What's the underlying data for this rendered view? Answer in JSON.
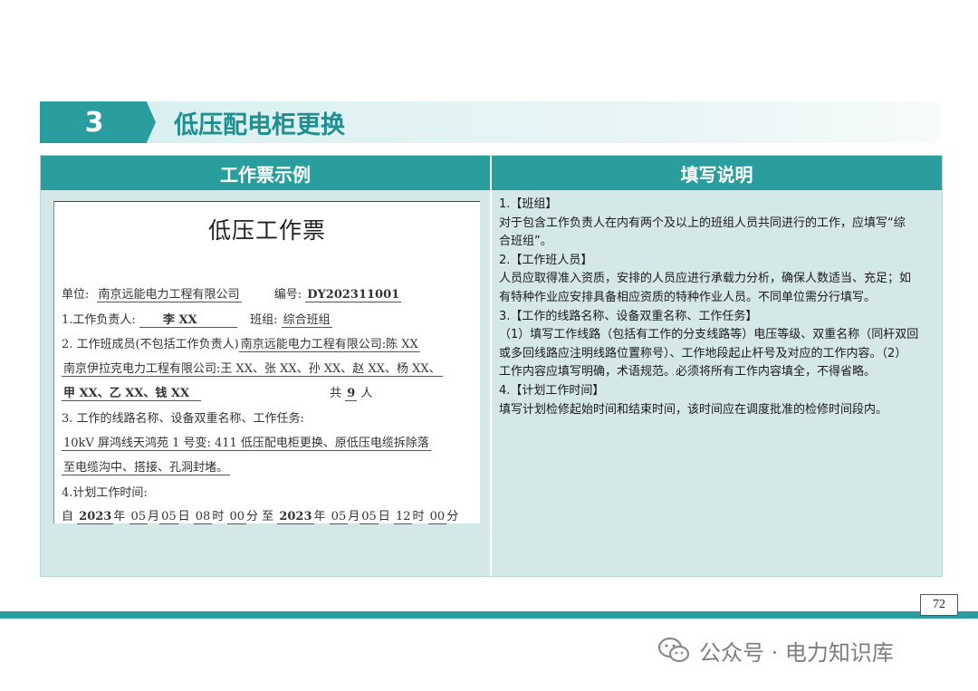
{
  "section": {
    "number": "3",
    "title": "低压配电柜更换"
  },
  "table": {
    "header_left": "工作票示例",
    "header_right": "填写说明"
  },
  "ticket": {
    "title": "低压工作票",
    "unit_label": "单位:",
    "unit_value": "南京远能电力工程有限公司",
    "number_label": "编号:",
    "number_value": "DY202311001",
    "leader_label": "1.工作负责人:",
    "leader_value": "李 XX",
    "team_label": "班组:",
    "team_value": "综合班组",
    "members_label": "2. 工作班成员(不包括工作负责人)",
    "members_line1_value": "南京远能电力工程有限公司:陈 XX",
    "members_line2_value": "南京伊拉克电力工程有限公司:王 XX、张 XX、孙 XX、赵 XX、杨 XX、",
    "members_line3_value": "甲 XX、乙 XX、钱 XX",
    "members_total_prefix": "共",
    "members_total_value": "9",
    "members_total_suffix": "人",
    "task_label": "3. 工作的线路名称、设备双重名称、工作任务:",
    "task_line1": "10kV 屏鸿线天鸿苑 1 号变: 411 低压配电柜更换、原低压电缆拆除落",
    "task_line2": "至电缆沟中、搭接、孔洞封堵。",
    "time_label": "4.计划工作时间:",
    "time_from": "自",
    "time_start_year": "2023",
    "time_start_month": "05",
    "time_start_day": "05",
    "time_start_hour": "08",
    "time_start_min": "00",
    "time_to": "至",
    "time_end_year": "2023",
    "time_end_month": "05",
    "time_end_day": "05",
    "time_end_hour": "12",
    "time_end_min": "00",
    "u_year": "年",
    "u_month": "月",
    "u_day": "日",
    "u_hour": "时",
    "u_min": "分"
  },
  "instructions": [
    "1.【班组】",
    "对于包含工作负责人在内有两个及以上的班组人员共同进行的工作，应填写“综",
    "合班组”。",
    "2.【工作班人员】",
    "人员应取得准入资质，安排的人员应进行承载力分析，确保人数适当、充足；如",
    "有特种作业应安排具备相应资质的特种作业人员。不同单位需分行填写。",
    "3.【工作的线路名称、设备双重名称、工作任务】",
    "（1）填写工作线路（包括有工作的分支线路等）电压等级、双重名称（同杆双回",
    "或多回线路应注明线路位置称号）、工作地段起止杆号及对应的工作内容。（2）",
    "工作内容应填写明确，术语规范。必须将所有工作内容填全，不得省略。",
    "4.【计划工作时间】",
    "填写计划检修起始时间和结束时间，该时间应在调度批准的检修时间段内。"
  ],
  "page_number": "72",
  "watermark": "公众号 · 电力知识库",
  "colors": {
    "accent": "#2a9e9f",
    "panel": "#d5e8e8"
  }
}
